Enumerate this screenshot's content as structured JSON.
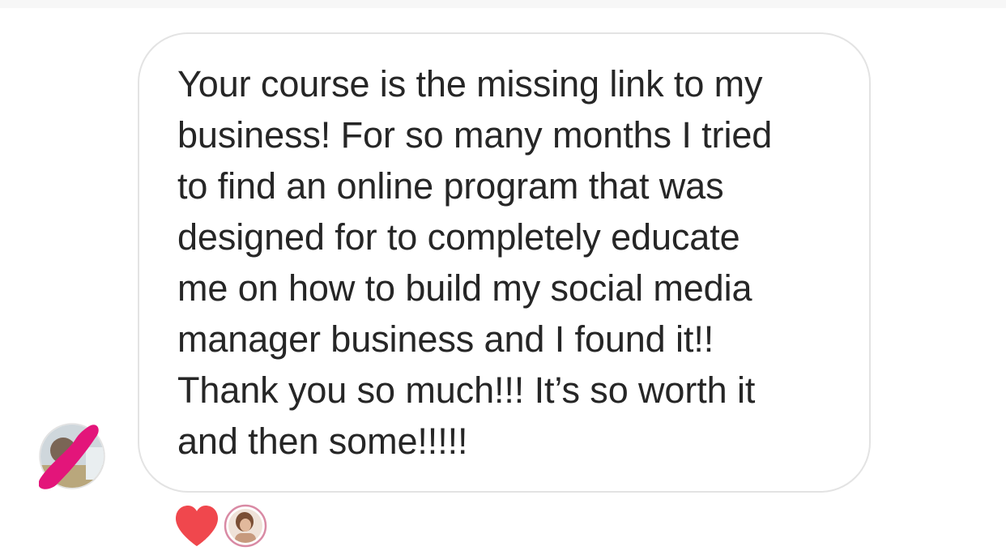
{
  "message": {
    "text": "Your course is the missing link to my\nbusiness! For so many months I tried\nto find an online program that was\ndesigned for to completely educate\nme on how to build my social media\nmanager business and I found it!!\nThank you so much!!! It’s so worth it\nand then some!!!!!"
  },
  "reactions": [
    {
      "icon": "heart-icon",
      "color": "#f0474d"
    },
    {
      "icon": "reactor-avatar"
    }
  ],
  "colors": {
    "bubble_border": "#e3e3e3",
    "text": "#262626",
    "redaction_scribble": "#e3157a"
  }
}
